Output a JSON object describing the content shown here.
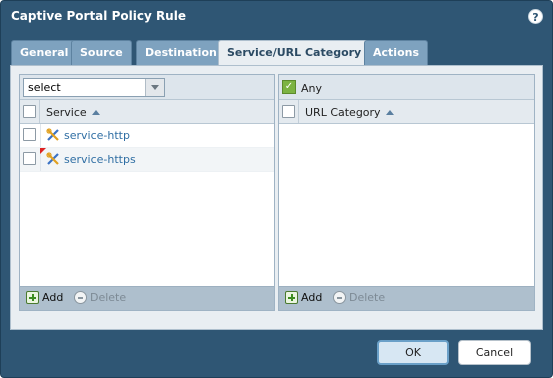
{
  "window": {
    "title": "Captive Portal Policy Rule",
    "help_glyph": "?"
  },
  "tabs": [
    {
      "label": "General",
      "active": false
    },
    {
      "label": "Source",
      "active": false
    },
    {
      "label": "Destination",
      "active": false
    },
    {
      "label": "Service/URL Category",
      "active": true
    },
    {
      "label": "Actions",
      "active": false
    }
  ],
  "service_pane": {
    "select_value": "select",
    "column_header": "Service",
    "rows": [
      {
        "name": "service-http",
        "icon": "service-icon",
        "modified": false
      },
      {
        "name": "service-https",
        "icon": "service-icon",
        "modified": true
      }
    ],
    "add_label": "Add",
    "delete_label": "Delete"
  },
  "url_pane": {
    "any_label": "Any",
    "any_checked": true,
    "column_header": "URL Category",
    "rows": [],
    "add_label": "Add",
    "delete_label": "Delete"
  },
  "buttons": {
    "ok_label": "OK",
    "cancel_label": "Cancel"
  },
  "colors": {
    "frame": "#2f5674",
    "tab_inactive": "#7ea2bf",
    "tab_active": "#e9eef2",
    "link": "#2f6ea3",
    "check_green": "#7cb342"
  }
}
